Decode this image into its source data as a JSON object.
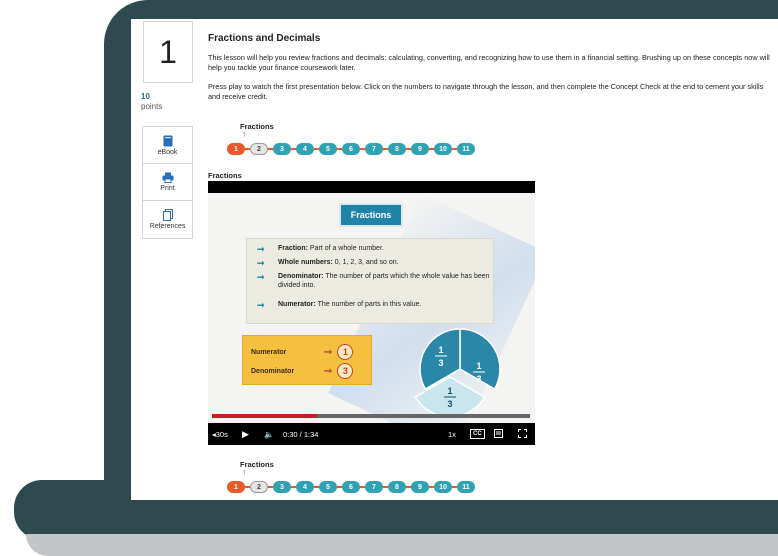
{
  "lesson": {
    "number": "1",
    "points_value": "10",
    "points_label": "points"
  },
  "tools": [
    {
      "label": "eBook",
      "icon": "ebook-icon"
    },
    {
      "label": "Print",
      "icon": "print-icon"
    },
    {
      "label": "References",
      "icon": "references-icon"
    }
  ],
  "content": {
    "title": "Fractions and Decimals",
    "para1": "This lesson will help you review fractions and decimals: calculating, converting, and recognizing how to use them in a financial setting. Brushing up on these concepts now will help you tackle your finance coursework later.",
    "para2": "Press play to watch the first presentation below. Click on the numbers to navigate through the lesson, and then complete the Concept Check at the end to cement your skills and receive credit."
  },
  "nav": {
    "current_label": "Fractions",
    "steps": [
      "1",
      "2",
      "3",
      "4",
      "5",
      "6",
      "7",
      "8",
      "9",
      "10",
      "11"
    ],
    "completed": 1,
    "current": 2
  },
  "video": {
    "label": "Fractions",
    "slide_title": "Fractions",
    "definitions": [
      {
        "term": "Fraction:",
        "text": "Part of a whole number."
      },
      {
        "term": "Whole numbers:",
        "text": "0, 1, 2, 3, and so on."
      },
      {
        "term": "Denominator:",
        "text": "The number of parts which the whole value has been divided into."
      },
      {
        "term": "Numerator:",
        "text": "The number of parts in this value."
      }
    ],
    "numerator_label": "Numerator",
    "denominator_label": "Denominator",
    "numerator_value": "1",
    "denominator_value": "3",
    "pie_fraction_num": "1",
    "pie_fraction_den": "3",
    "progress_fraction": 0.33,
    "rewind_label": "◂30s",
    "time": "0:30 / 1:34",
    "speed": "1x",
    "cc_label": "CC"
  },
  "colors": {
    "frame": "#2f4a4e",
    "step_teal": "#2fa3b3",
    "step_orange": "#e85a29",
    "slide_blue": "#1f84a8",
    "progress_red": "#c0202a"
  }
}
